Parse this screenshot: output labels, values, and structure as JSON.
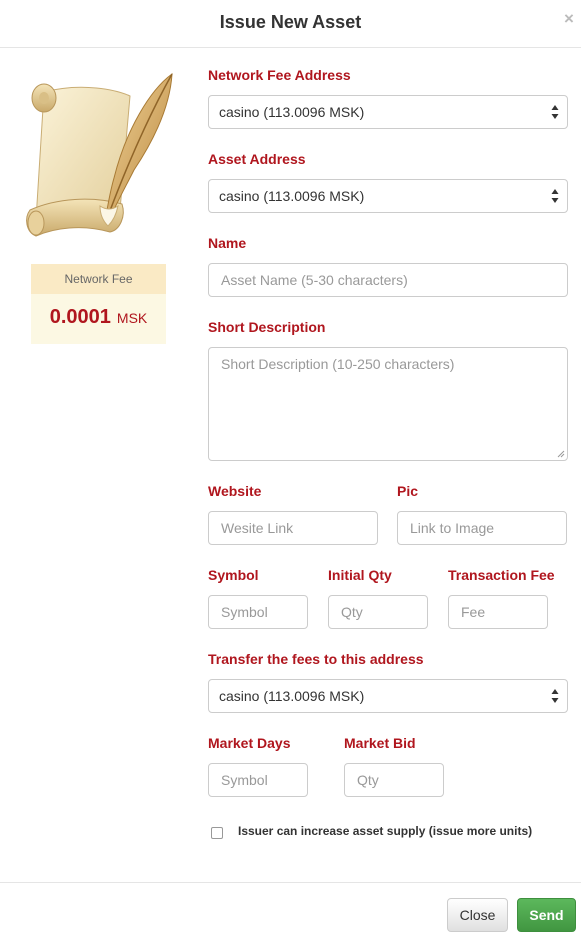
{
  "modal": {
    "title": "Issue New Asset",
    "close_glyph": "×"
  },
  "fee": {
    "label": "Network Fee",
    "amount": "0.0001",
    "unit": "MSK"
  },
  "form": {
    "network_fee_address": {
      "label": "Network Fee Address",
      "value": "casino (113.0096 MSK)"
    },
    "asset_address": {
      "label": "Asset Address",
      "value": "casino (113.0096 MSK)"
    },
    "name": {
      "label": "Name",
      "placeholder": "Asset Name (5-30 characters)"
    },
    "short_description": {
      "label": "Short Description",
      "placeholder": "Short Description (10-250 characters)"
    },
    "website": {
      "label": "Website",
      "placeholder": "Wesite Link"
    },
    "pic": {
      "label": "Pic",
      "placeholder": "Link to Image"
    },
    "symbol": {
      "label": "Symbol",
      "placeholder": "Symbol"
    },
    "initial_qty": {
      "label": "Initial Qty",
      "placeholder": "Qty"
    },
    "transaction_fee": {
      "label": "Transaction Fee",
      "placeholder": "Fee"
    },
    "transfer_fees_address": {
      "label": "Transfer the fees to this address",
      "value": "casino (113.0096 MSK)"
    },
    "market_days": {
      "label": "Market Days",
      "placeholder": "Symbol"
    },
    "market_bid": {
      "label": "Market Bid",
      "placeholder": "Qty"
    },
    "increase_supply": {
      "label": "Issuer can increase asset supply (issue more units)",
      "checked": false
    }
  },
  "footer": {
    "close_label": "Close",
    "send_label": "Send"
  },
  "icons": {
    "illustration": "scroll-and-quill-icon",
    "select_arrows": "select-arrows-icon",
    "close": "close-icon"
  },
  "colors": {
    "label_red": "#b0161e",
    "fee_box_bg": "#fcf8e3",
    "fee_label_bg": "#faeac5",
    "send_green": "#4cae4c"
  }
}
